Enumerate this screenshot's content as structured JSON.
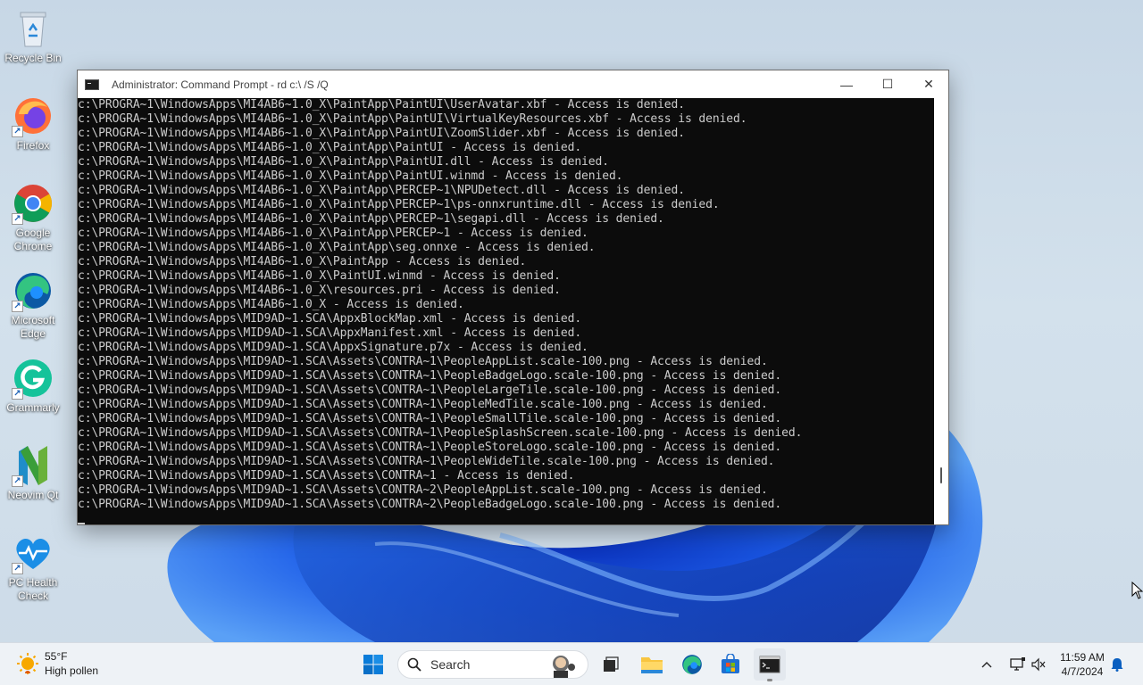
{
  "desktop": {
    "icons": [
      {
        "label": "Recycle Bin"
      },
      {
        "label": "Firefox"
      },
      {
        "label": "Google Chrome"
      },
      {
        "label": "Microsoft Edge"
      },
      {
        "label": "Grammarly"
      },
      {
        "label": "Neovim Qt"
      },
      {
        "label": "PC Health Check"
      }
    ]
  },
  "window": {
    "title": "Administrator: Command Prompt - rd  c:\\ /S /Q",
    "minimize_glyph": "—",
    "maximize_glyph": "☐",
    "close_glyph": "✕",
    "lines": [
      "c:\\PROGRA~1\\WindowsApps\\MI4AB6~1.0_X\\PaintApp\\PaintUI\\UserAvatar.xbf - Access is denied.",
      "c:\\PROGRA~1\\WindowsApps\\MI4AB6~1.0_X\\PaintApp\\PaintUI\\VirtualKeyResources.xbf - Access is denied.",
      "c:\\PROGRA~1\\WindowsApps\\MI4AB6~1.0_X\\PaintApp\\PaintUI\\ZoomSlider.xbf - Access is denied.",
      "c:\\PROGRA~1\\WindowsApps\\MI4AB6~1.0_X\\PaintApp\\PaintUI - Access is denied.",
      "c:\\PROGRA~1\\WindowsApps\\MI4AB6~1.0_X\\PaintApp\\PaintUI.dll - Access is denied.",
      "c:\\PROGRA~1\\WindowsApps\\MI4AB6~1.0_X\\PaintApp\\PaintUI.winmd - Access is denied.",
      "c:\\PROGRA~1\\WindowsApps\\MI4AB6~1.0_X\\PaintApp\\PERCEP~1\\NPUDetect.dll - Access is denied.",
      "c:\\PROGRA~1\\WindowsApps\\MI4AB6~1.0_X\\PaintApp\\PERCEP~1\\ps-onnxruntime.dll - Access is denied.",
      "c:\\PROGRA~1\\WindowsApps\\MI4AB6~1.0_X\\PaintApp\\PERCEP~1\\segapi.dll - Access is denied.",
      "c:\\PROGRA~1\\WindowsApps\\MI4AB6~1.0_X\\PaintApp\\PERCEP~1 - Access is denied.",
      "c:\\PROGRA~1\\WindowsApps\\MI4AB6~1.0_X\\PaintApp\\seg.onnxe - Access is denied.",
      "c:\\PROGRA~1\\WindowsApps\\MI4AB6~1.0_X\\PaintApp - Access is denied.",
      "c:\\PROGRA~1\\WindowsApps\\MI4AB6~1.0_X\\PaintUI.winmd - Access is denied.",
      "c:\\PROGRA~1\\WindowsApps\\MI4AB6~1.0_X\\resources.pri - Access is denied.",
      "c:\\PROGRA~1\\WindowsApps\\MI4AB6~1.0_X - Access is denied.",
      "c:\\PROGRA~1\\WindowsApps\\MID9AD~1.SCA\\AppxBlockMap.xml - Access is denied.",
      "c:\\PROGRA~1\\WindowsApps\\MID9AD~1.SCA\\AppxManifest.xml - Access is denied.",
      "c:\\PROGRA~1\\WindowsApps\\MID9AD~1.SCA\\AppxSignature.p7x - Access is denied.",
      "c:\\PROGRA~1\\WindowsApps\\MID9AD~1.SCA\\Assets\\CONTRA~1\\PeopleAppList.scale-100.png - Access is denied.",
      "c:\\PROGRA~1\\WindowsApps\\MID9AD~1.SCA\\Assets\\CONTRA~1\\PeopleBadgeLogo.scale-100.png - Access is denied.",
      "c:\\PROGRA~1\\WindowsApps\\MID9AD~1.SCA\\Assets\\CONTRA~1\\PeopleLargeTile.scale-100.png - Access is denied.",
      "c:\\PROGRA~1\\WindowsApps\\MID9AD~1.SCA\\Assets\\CONTRA~1\\PeopleMedTile.scale-100.png - Access is denied.",
      "c:\\PROGRA~1\\WindowsApps\\MID9AD~1.SCA\\Assets\\CONTRA~1\\PeopleSmallTile.scale-100.png - Access is denied.",
      "c:\\PROGRA~1\\WindowsApps\\MID9AD~1.SCA\\Assets\\CONTRA~1\\PeopleSplashScreen.scale-100.png - Access is denied.",
      "c:\\PROGRA~1\\WindowsApps\\MID9AD~1.SCA\\Assets\\CONTRA~1\\PeopleStoreLogo.scale-100.png - Access is denied.",
      "c:\\PROGRA~1\\WindowsApps\\MID9AD~1.SCA\\Assets\\CONTRA~1\\PeopleWideTile.scale-100.png - Access is denied.",
      "c:\\PROGRA~1\\WindowsApps\\MID9AD~1.SCA\\Assets\\CONTRA~1 - Access is denied.",
      "c:\\PROGRA~1\\WindowsApps\\MID9AD~1.SCA\\Assets\\CONTRA~2\\PeopleAppList.scale-100.png - Access is denied.",
      "c:\\PROGRA~1\\WindowsApps\\MID9AD~1.SCA\\Assets\\CONTRA~2\\PeopleBadgeLogo.scale-100.png - Access is denied."
    ]
  },
  "taskbar": {
    "weather": {
      "temp": "55°F",
      "condition": "High pollen"
    },
    "search_label": "Search",
    "clock": {
      "time": "11:59 AM",
      "date": "4/7/2024"
    }
  },
  "colors": {
    "console_bg": "#0c0c0c",
    "console_text": "#cccccc",
    "taskbar_bg": "#eef2f6",
    "accent": "#0067c0"
  }
}
